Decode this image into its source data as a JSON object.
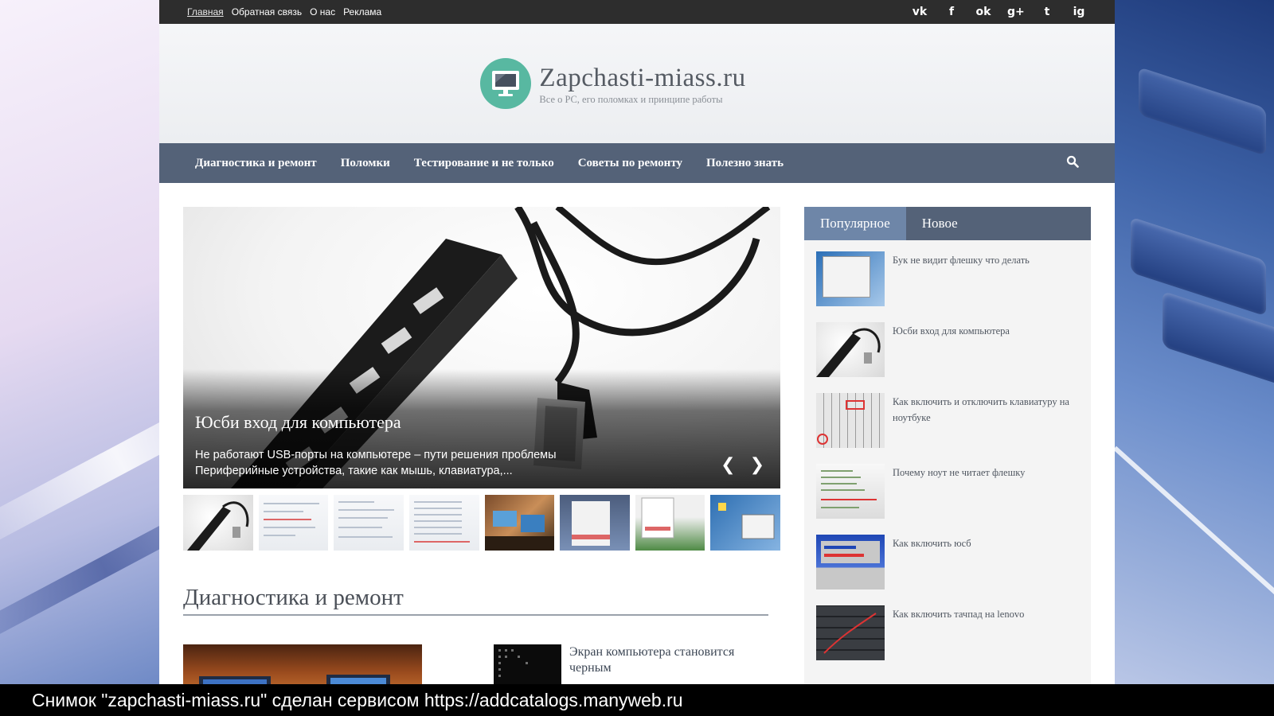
{
  "topbar": {
    "links": [
      "Главная",
      "Обратная связь",
      "О нас",
      "Реклама"
    ],
    "social": [
      "vk-icon",
      "facebook-icon",
      "odnoklassniki-icon",
      "google-plus-icon",
      "twitter-icon",
      "instagram-icon"
    ],
    "social_glyphs": [
      "vk",
      "f",
      "ok",
      "g+",
      "t",
      "ig"
    ]
  },
  "header": {
    "site_title": "Zapchasti-miass.ru",
    "tagline": "Все о PC, его поломках и принципе работы",
    "logo_color": "#58b8a1"
  },
  "nav": {
    "items": [
      "Диагностика и ремонт",
      "Поломки",
      "Тестирование и не только",
      "Советы по ремонту",
      "Полезно знать"
    ],
    "search_icon": "search-icon",
    "background": "#546278"
  },
  "slider": {
    "title": "Юсби вход для компьютера",
    "description_line1": "Не работают USB-порты на компьютере – пути решения проблемы",
    "description_line2": "Периферийные устройства, такие как мышь, клавиатура,..."
  },
  "section": {
    "title": "Диагностика и ремонт",
    "post2_title": "Экран компьютера становится черным"
  },
  "sidebar": {
    "tabs": [
      "Популярное",
      "Новое"
    ],
    "popular": [
      "Бук не видит флешку что делать",
      "Юсби вход для компьютера",
      "Как включить и отключить клавиатуру на ноутбуке",
      "Почему ноут не читает флешку",
      "Как включить юсб",
      "Как включить тачпад на lenovo"
    ]
  },
  "caption": "Снимок \"zapchasti-miass.ru\" сделан сервисом https://addcatalogs.manyweb.ru"
}
